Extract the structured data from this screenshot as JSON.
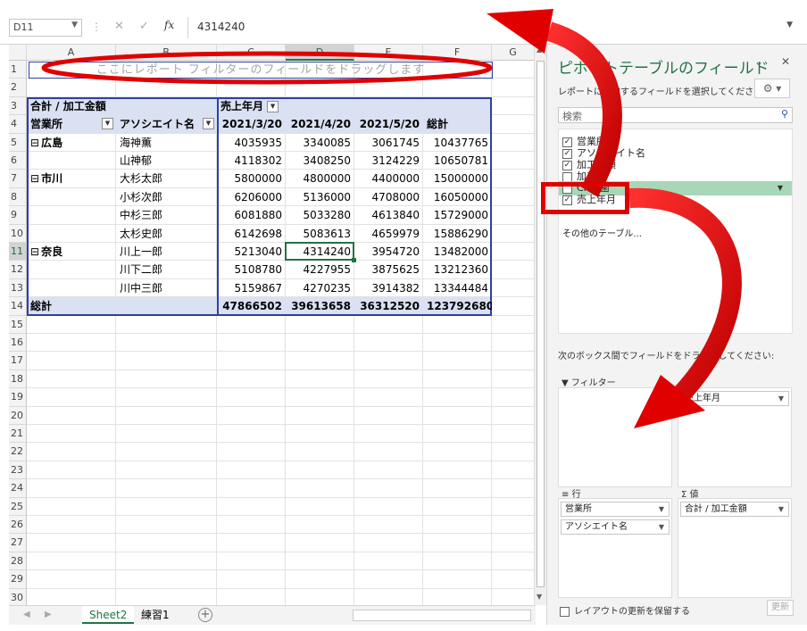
{
  "formula_bar": {
    "name_box": "D11",
    "formula": "4314240"
  },
  "columns": [
    "A",
    "B",
    "C",
    "D",
    "E",
    "F",
    "G"
  ],
  "selected_column": "D",
  "rows": [
    "1",
    "2",
    "3",
    "4",
    "5",
    "6",
    "7",
    "8",
    "9",
    "10",
    "11",
    "12",
    "13",
    "14",
    "15",
    "16",
    "17",
    "18",
    "19",
    "20",
    "21",
    "22",
    "23",
    "24",
    "25",
    "26",
    "27",
    "28",
    "29",
    "30"
  ],
  "selected_row": "11",
  "pivot": {
    "filter_hint": "ここにレポート フィルターのフィールドをドラッグします",
    "value_header": "合計 / 加工金額",
    "col_field": "売上年月",
    "row_field1": "営業所",
    "row_field2": "アソシエイト名",
    "dates": [
      "2021/3/20",
      "2021/4/20",
      "2021/5/20"
    ],
    "grand_total_label": "総計",
    "groups": [
      {
        "office": "広島",
        "rows": [
          {
            "name": "海神薫",
            "v": [
              "4035935",
              "3340085",
              "3061745",
              "10437765"
            ]
          },
          {
            "name": "山神郁",
            "v": [
              "4118302",
              "3408250",
              "3124229",
              "10650781"
            ]
          }
        ]
      },
      {
        "office": "市川",
        "rows": [
          {
            "name": "大杉太郎",
            "v": [
              "5800000",
              "4800000",
              "4400000",
              "15000000"
            ]
          },
          {
            "name": "小杉次郎",
            "v": [
              "6206000",
              "5136000",
              "4708000",
              "16050000"
            ]
          },
          {
            "name": "中杉三郎",
            "v": [
              "6081880",
              "5033280",
              "4613840",
              "15729000"
            ]
          },
          {
            "name": "太杉史郎",
            "v": [
              "6142698",
              "5083613",
              "4659979",
              "15886290"
            ]
          }
        ]
      },
      {
        "office": "奈良",
        "rows": [
          {
            "name": "川上一郎",
            "v": [
              "5213040",
              "4314240",
              "3954720",
              "13482000"
            ]
          },
          {
            "name": "川下二郎",
            "v": [
              "5108780",
              "4227955",
              "3875625",
              "13212360"
            ]
          },
          {
            "name": "川中三郎",
            "v": [
              "5159867",
              "4270235",
              "3914382",
              "13344484"
            ]
          }
        ]
      }
    ],
    "totals": [
      "47866502",
      "39613658",
      "36312520",
      "123792680"
    ]
  },
  "sheet_tabs": {
    "active": "Sheet2",
    "other": "練習1"
  },
  "pane": {
    "title": "ピボットテーブルのフィールド",
    "subtitle": "レポートに追加するフィールドを選択してください:",
    "search_placeholder": "検索",
    "fields": [
      {
        "label": "営業所",
        "checked": true
      },
      {
        "label": "アソシエイト名",
        "checked": true
      },
      {
        "label": "加工金額",
        "checked": true
      },
      {
        "label": "加工日",
        "checked": false
      },
      {
        "label": "CK義歯",
        "checked": false,
        "highlight": true
      },
      {
        "label": "売上年月",
        "checked": true
      }
    ],
    "more_tables": "その他のテーブル...",
    "drag_hint": "次のボックス間でフィールドをドラッグしてください:",
    "filter_label": "フィルター",
    "columns_label": "列",
    "rows_label": "行",
    "values_label": "値",
    "columns_items": [
      "売上年月"
    ],
    "rows_items": [
      "営業所",
      "アソシエイト名"
    ],
    "values_items": [
      "合計 / 加工金額"
    ],
    "defer_label": "レイアウトの更新を保留する",
    "update_label": "更新"
  },
  "colors": {
    "accent": "#217346",
    "pivot_header": "#d9e1f2",
    "annotation": "#e00000"
  }
}
